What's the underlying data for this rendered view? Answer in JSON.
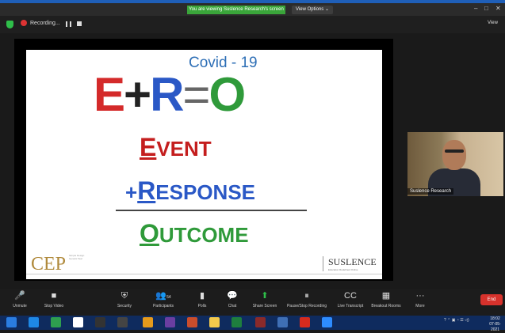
{
  "banner": {
    "text": "You are viewing Suslence Research's screen"
  },
  "view_options": {
    "label": "View Options ⌄"
  },
  "window_controls": [
    "–",
    "□",
    "✕"
  ],
  "recording": {
    "label": "Recording..."
  },
  "view_button": {
    "label": "View"
  },
  "slide": {
    "title": "Covid - 19",
    "equation": {
      "e": "E",
      "plus": "+",
      "r": "R",
      "eq": "=",
      "o": "O"
    },
    "event": {
      "cap": "E",
      "rest": "VENT"
    },
    "response": {
      "plus": "+",
      "cap": "R",
      "rest": "ESPONSE"
    },
    "outcome": {
      "cap": "O",
      "rest": "UTCOME"
    },
    "left_logo": "CEP",
    "left_logo_small": "Simple Design Genetic Teal",
    "right_logo": "SUSLENCE",
    "right_logo_small": "Education Redefined Online"
  },
  "participant_video": {
    "label": "Suslence Research"
  },
  "toolbar": {
    "unmute": "Unmute",
    "stop_video": "Stop Video",
    "security": "Security",
    "participants": "Participants",
    "participants_count": "54",
    "polls": "Polls",
    "chat": "Chat",
    "share_screen": "Share Screen",
    "pause_recording": "Pause/Stop Recording",
    "live_transcript": "Live Transcript",
    "breakout_rooms": "Breakout Rooms",
    "more": "More",
    "end": "End"
  },
  "taskbar": {
    "time": "18:02",
    "date": "07-05-2021"
  }
}
